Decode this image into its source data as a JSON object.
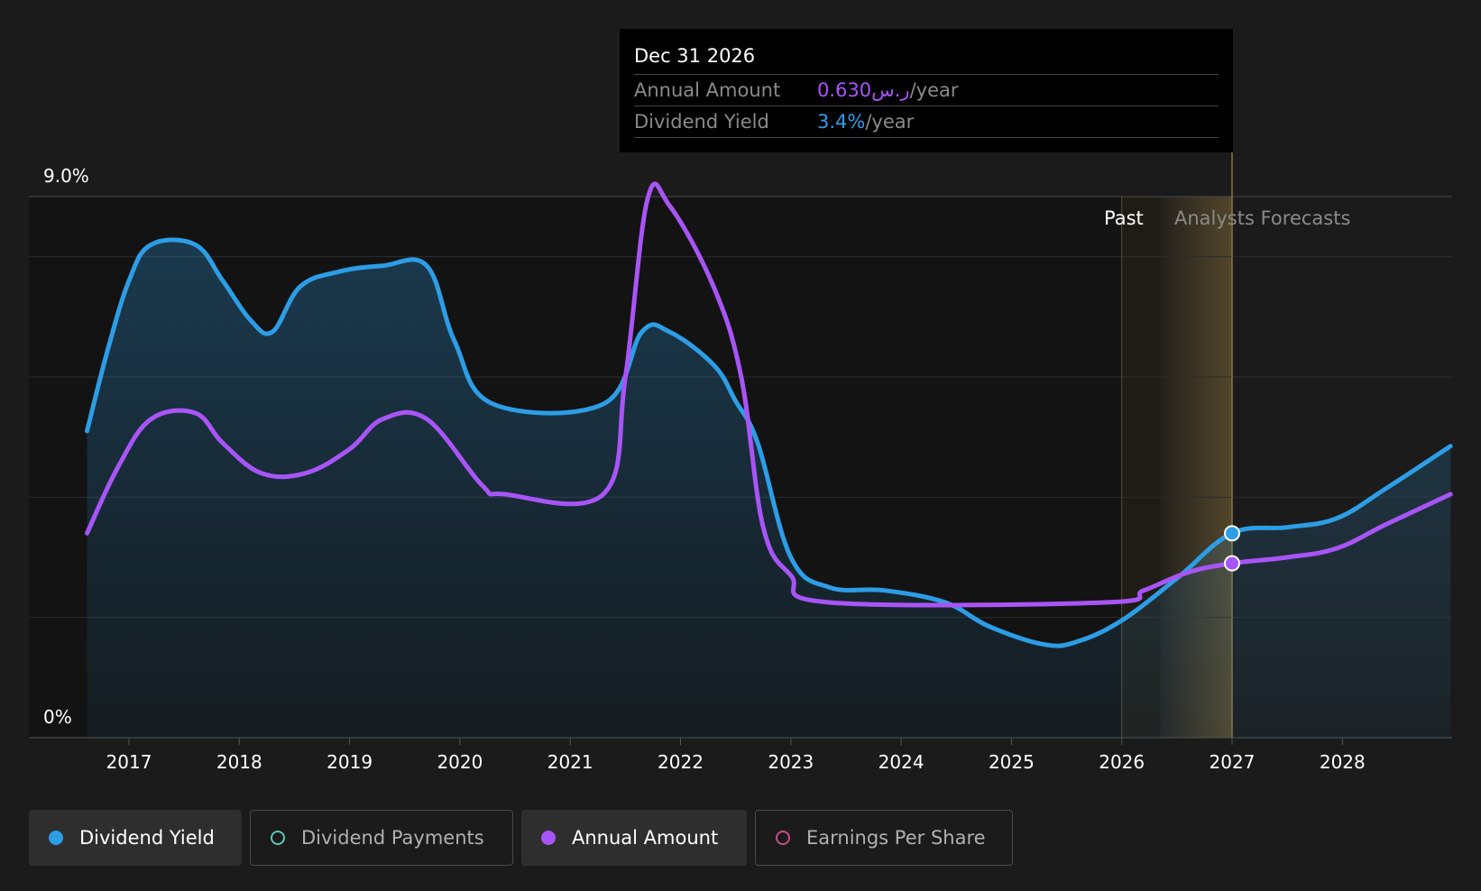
{
  "colors": {
    "yield": "#2d9de6",
    "annual": "#a855f7",
    "payments": "#5ec5b8",
    "eps": "#c44f8a",
    "forecast_band": "#6b5a30"
  },
  "tooltip": {
    "date": "Dec 31 2026",
    "rows": [
      {
        "key": "Annual Amount",
        "value": "0.630ر.س",
        "unit": "/year"
      },
      {
        "key": "Dividend Yield",
        "value": "3.4%",
        "unit": "/year"
      }
    ]
  },
  "regions": {
    "past": "Past",
    "forecast": "Analysts Forecasts"
  },
  "legend": [
    {
      "label": "Dividend Yield",
      "icon": "filled-dot-icon",
      "active": true
    },
    {
      "label": "Dividend Payments",
      "icon": "hollow-dot-icon",
      "active": false
    },
    {
      "label": "Annual Amount",
      "icon": "filled-dot-icon",
      "active": true
    },
    {
      "label": "Earnings Per Share",
      "icon": "hollow-dot-icon",
      "active": false
    }
  ],
  "chart_data": {
    "type": "line",
    "y_ticks": [
      "9.0%",
      "0%"
    ],
    "ylim": [
      0,
      9.0
    ],
    "x_ticks": [
      "2017",
      "2018",
      "2019",
      "2020",
      "2021",
      "2022",
      "2023",
      "2024",
      "2025",
      "2026",
      "2027",
      "2028"
    ],
    "xlim": [
      2016.6,
      2028.98
    ],
    "past_forecast_boundary": 2026.0,
    "forecast_highlight": [
      2026.35,
      2027.0
    ],
    "tooltip_x": 2027.0,
    "series": [
      {
        "name": "Dividend Yield",
        "color": "#2d9de6",
        "area": true,
        "points": [
          [
            2016.62,
            5.1
          ],
          [
            2016.8,
            6.4
          ],
          [
            2017.0,
            7.6
          ],
          [
            2017.2,
            8.2
          ],
          [
            2017.6,
            8.2
          ],
          [
            2017.85,
            7.6
          ],
          [
            2018.1,
            6.95
          ],
          [
            2018.3,
            6.75
          ],
          [
            2018.55,
            7.5
          ],
          [
            2018.9,
            7.75
          ],
          [
            2019.3,
            7.85
          ],
          [
            2019.7,
            7.85
          ],
          [
            2019.95,
            6.6
          ],
          [
            2020.3,
            5.55
          ],
          [
            2021.3,
            5.55
          ],
          [
            2021.65,
            6.75
          ],
          [
            2021.9,
            6.75
          ],
          [
            2022.3,
            6.2
          ],
          [
            2022.5,
            5.6
          ],
          [
            2022.7,
            4.9
          ],
          [
            2023.0,
            3.0
          ],
          [
            2023.35,
            2.5
          ],
          [
            2023.85,
            2.45
          ],
          [
            2024.4,
            2.25
          ],
          [
            2024.8,
            1.85
          ],
          [
            2025.3,
            1.55
          ],
          [
            2025.6,
            1.6
          ],
          [
            2026.0,
            1.95
          ],
          [
            2026.5,
            2.65
          ],
          [
            2027.0,
            3.4
          ],
          [
            2027.5,
            3.5
          ],
          [
            2027.95,
            3.65
          ],
          [
            2028.4,
            4.15
          ],
          [
            2028.98,
            4.85
          ]
        ]
      },
      {
        "name": "Annual Amount",
        "color": "#a855f7",
        "area": false,
        "points": [
          [
            2016.62,
            3.4
          ],
          [
            2016.9,
            4.5
          ],
          [
            2017.2,
            5.3
          ],
          [
            2017.6,
            5.4
          ],
          [
            2017.85,
            4.9
          ],
          [
            2018.2,
            4.4
          ],
          [
            2018.6,
            4.4
          ],
          [
            2019.0,
            4.8
          ],
          [
            2019.3,
            5.3
          ],
          [
            2019.7,
            5.3
          ],
          [
            2020.2,
            4.2
          ],
          [
            2020.4,
            4.05
          ],
          [
            2021.3,
            4.05
          ],
          [
            2021.5,
            6.0
          ],
          [
            2021.7,
            8.95
          ],
          [
            2021.9,
            8.85
          ],
          [
            2022.3,
            7.5
          ],
          [
            2022.55,
            6.0
          ],
          [
            2022.75,
            3.5
          ],
          [
            2023.0,
            2.7
          ],
          [
            2023.35,
            2.25
          ],
          [
            2025.85,
            2.25
          ],
          [
            2026.2,
            2.45
          ],
          [
            2026.6,
            2.75
          ],
          [
            2027.0,
            2.9
          ],
          [
            2027.5,
            3.0
          ],
          [
            2027.95,
            3.15
          ],
          [
            2028.4,
            3.55
          ],
          [
            2028.98,
            4.05
          ]
        ]
      }
    ],
    "markers": [
      {
        "series": "Dividend Yield",
        "x": 2027.0,
        "y": 3.4
      },
      {
        "series": "Annual Amount",
        "x": 2027.0,
        "y": 2.9
      }
    ]
  }
}
